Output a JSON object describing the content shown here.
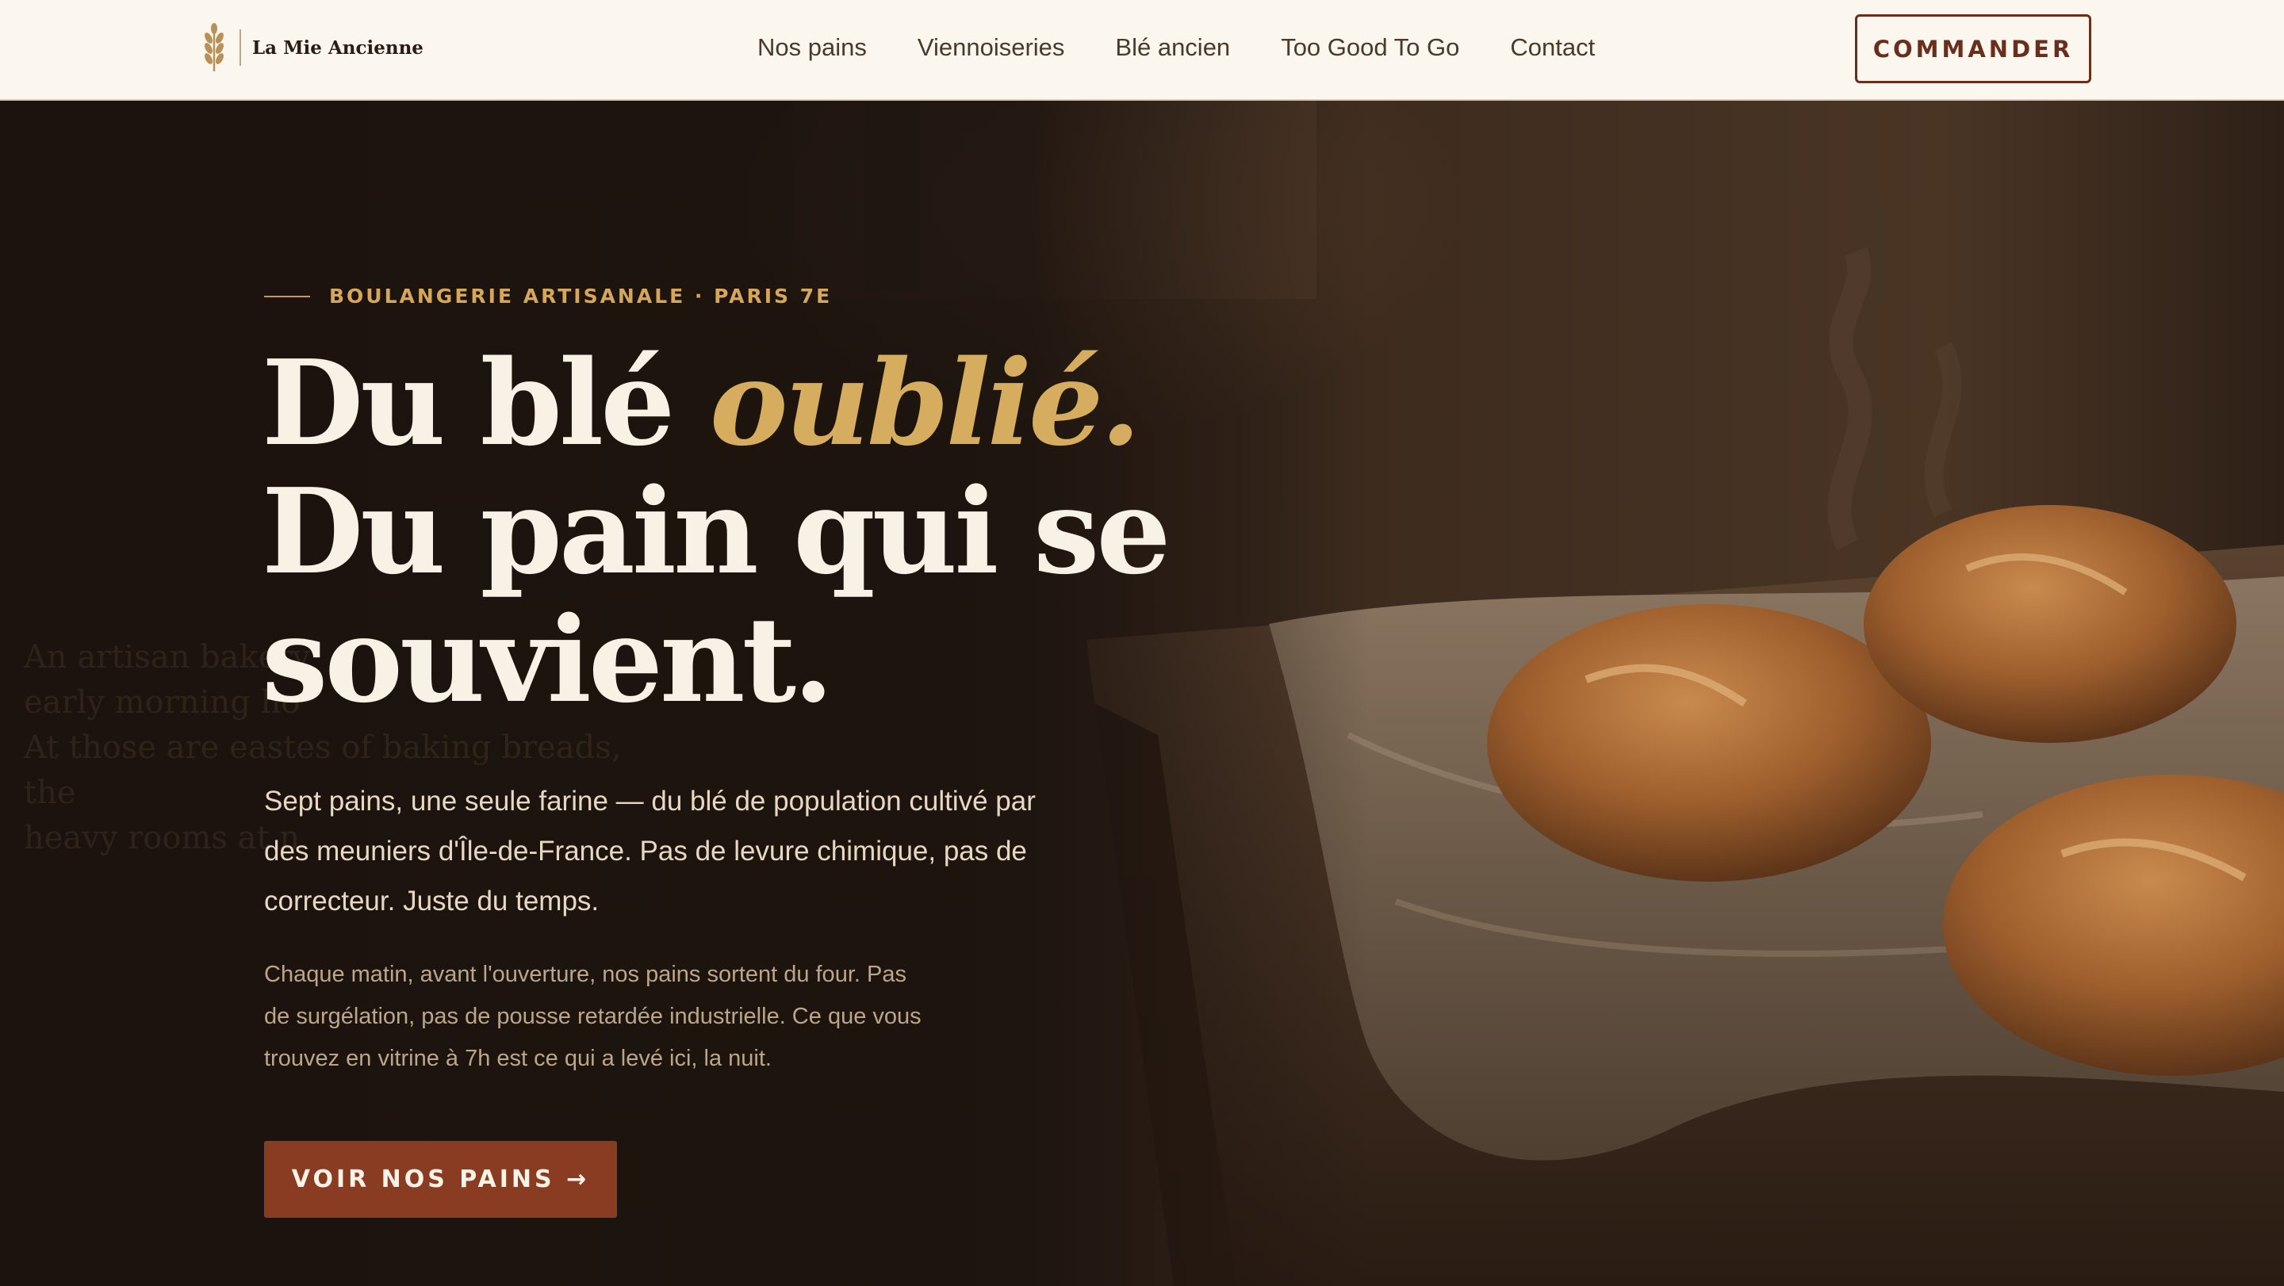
{
  "brand": {
    "name": "La Mie Ancienne",
    "icon": "wheat-icon"
  },
  "nav": {
    "items": [
      {
        "label": "Nos pains"
      },
      {
        "label": "Viennoiseries"
      },
      {
        "label": "Blé ancien"
      },
      {
        "label": "Too Good To Go"
      },
      {
        "label": "Contact"
      }
    ]
  },
  "header": {
    "order_label": "COMMANDER"
  },
  "hero": {
    "eyebrow": "BOULANGERIE ARTISANALE · PARIS 7E",
    "headline_part1": "Du blé ",
    "headline_accent": "oublié.",
    "headline_line2": "Du pain qui se",
    "headline_line3": "souvient.",
    "lead": "Sept pains, une seule farine — du blé de population cultivé par des meuniers d'Île-de-France. Pas de levure chimique, pas de correcteur. Juste du temps.",
    "sub": "Chaque matin, avant l'ouverture, nos pains sortent du four. Pas de surgélation, pas de pousse retardée industrielle. Ce que vous trouvez en vitrine à 7h est ce qui a levé ici, la nuit.",
    "cta_label": "VOIR NOS PAINS →",
    "ghost_text": "An artisan bakery\nearly morning ho\nAt those are eastes of baking breads, the\nheavy rooms at n"
  },
  "colors": {
    "header_bg": "#fbf7ef",
    "hero_bg": "#1f1611",
    "accent_gold": "#d6ac5f",
    "accent_rust": "#8a3c22",
    "text_light": "#f8f1e6"
  }
}
